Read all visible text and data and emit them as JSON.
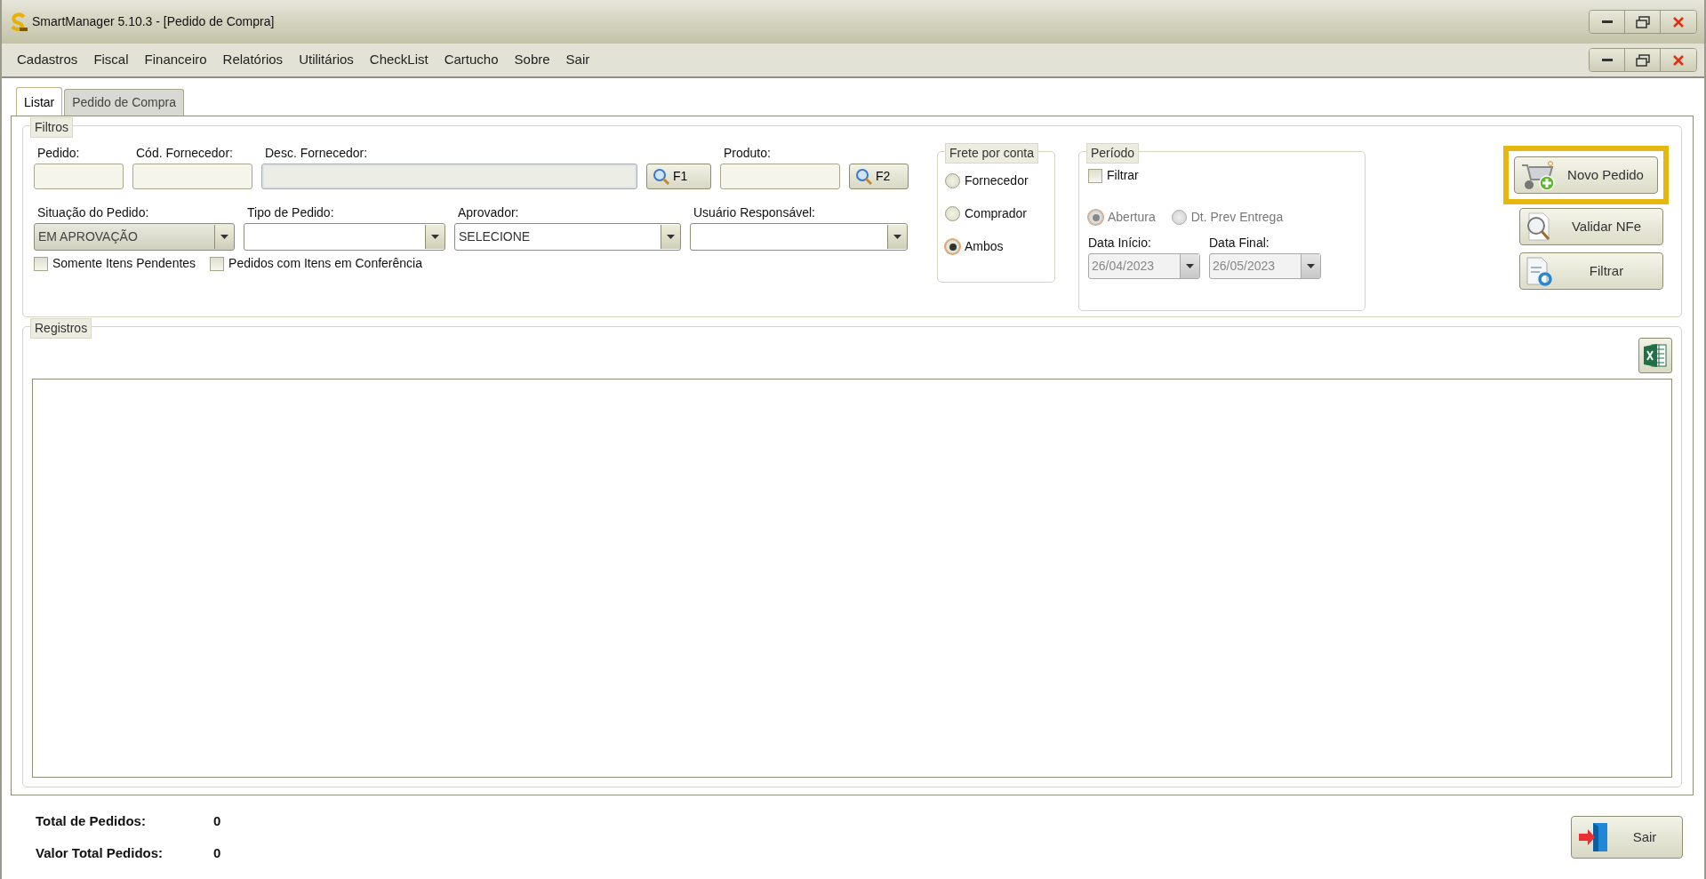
{
  "window": {
    "title": "SmartManager 5.10.3 - [Pedido de Compra]"
  },
  "menu": [
    "Cadastros",
    "Fiscal",
    "Financeiro",
    "Relatórios",
    "Utilitários",
    "CheckList",
    "Cartucho",
    "Sobre",
    "Sair"
  ],
  "tabs": [
    {
      "label": "Listar",
      "selected": true
    },
    {
      "label": "Pedido de Compra",
      "selected": false
    }
  ],
  "filters": {
    "title": "Filtros",
    "row1": [
      {
        "kind": "field",
        "label": "Pedido:",
        "disabled": false
      },
      {
        "kind": "field",
        "label": "Cód. Fornecedor:",
        "disabled": false
      },
      {
        "kind": "field",
        "label": "Desc. Fornecedor:",
        "disabled": true
      },
      {
        "kind": "lookup",
        "label": "F1"
      },
      {
        "kind": "field",
        "label": "Produto:",
        "disabled": false
      },
      {
        "kind": "lookup",
        "label": "F2"
      }
    ],
    "selects": [
      {
        "label": "Situação do Pedido:",
        "value": "EM APROVAÇÃO",
        "disabled": true
      },
      {
        "label": "Tipo de Pedido:",
        "disabled": false
      },
      {
        "label": "Aprovador:",
        "value": "SELECIONE",
        "disabled": false
      },
      {
        "label": "Usuário Responsável:",
        "disabled": false
      }
    ],
    "checkboxes": [
      {
        "label": "Somente Itens Pendentes",
        "checked": false
      },
      {
        "label": "Pedidos com Itens em Conferência",
        "checked": false
      }
    ],
    "freight": {
      "title": "Frete por conta",
      "options": [
        {
          "label": "Fornecedor",
          "selected": false
        },
        {
          "label": "Comprador",
          "selected": false
        },
        {
          "label": "Ambos",
          "selected": true
        }
      ]
    },
    "period": {
      "title": "Período",
      "filter": {
        "label": "Filtrar",
        "checked": false
      },
      "date_types": [
        {
          "label": "Abertura",
          "selected": true,
          "disabled": true
        },
        {
          "label": "Dt. Prev Entrega",
          "selected": false,
          "disabled": true
        }
      ],
      "dates": [
        {
          "label": "Data Início:",
          "value": "26/04/2023",
          "disabled": true
        },
        {
          "label": "Data Final:",
          "value": "26/05/2023",
          "disabled": true
        }
      ]
    },
    "actions": [
      {
        "kind": "cart",
        "label": "Novo Pedido",
        "highlighted": true
      },
      {
        "kind": "validate",
        "label": "Validar NFe",
        "highlighted": false
      },
      {
        "kind": "filter",
        "label": "Filtrar",
        "highlighted": false
      }
    ]
  },
  "records": {
    "title": "Registros"
  },
  "totals": [
    {
      "label": "Total de Pedidos:",
      "value": "0"
    },
    {
      "label": "Valor Total Pedidos:",
      "value": "0"
    }
  ],
  "exit_button": {
    "label": "Sair"
  }
}
